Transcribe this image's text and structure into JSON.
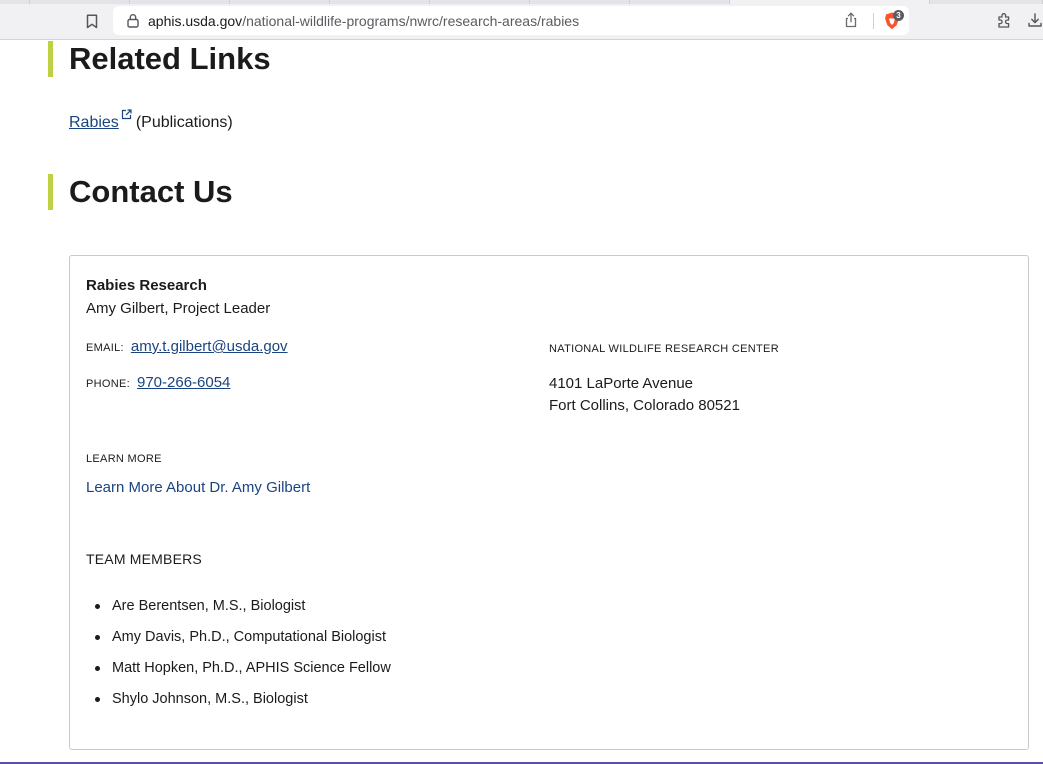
{
  "browser": {
    "url_host": "aphis.usda.gov",
    "url_path": "/national-wildlife-programs/nwrc/research-areas/rabies",
    "shields_count": "3"
  },
  "related_links": {
    "heading": "Related Links",
    "link_text": "Rabies",
    "suffix": "(Publications)"
  },
  "contact": {
    "heading": "Contact Us",
    "card": {
      "title": "Rabies Research",
      "leader": "Amy Gilbert, Project Leader",
      "email_label": "EMAIL:",
      "email": "amy.t.gilbert@usda.gov",
      "phone_label": "PHONE:",
      "phone": "970-266-6054",
      "org_name": "NATIONAL WILDLIFE RESEARCH CENTER",
      "address_line1": "4101 LaPorte Avenue",
      "address_line2": "Fort Collins, Colorado 80521",
      "learn_more_label": "LEARN MORE",
      "learn_more_link": "Learn More About Dr. Amy Gilbert",
      "team_label": "TEAM MEMBERS",
      "team_members": [
        "Are Berentsen, M.S., Biologist",
        "Amy Davis, Ph.D., Computational Biologist",
        "Matt Hopken, Ph.D., APHIS Science Fellow",
        "Shylo Johnson, M.S., Biologist"
      ]
    }
  },
  "colors": {
    "link": "#1a4480",
    "heading_accent": "#bdd142",
    "card_border": "#c9c9c9"
  }
}
